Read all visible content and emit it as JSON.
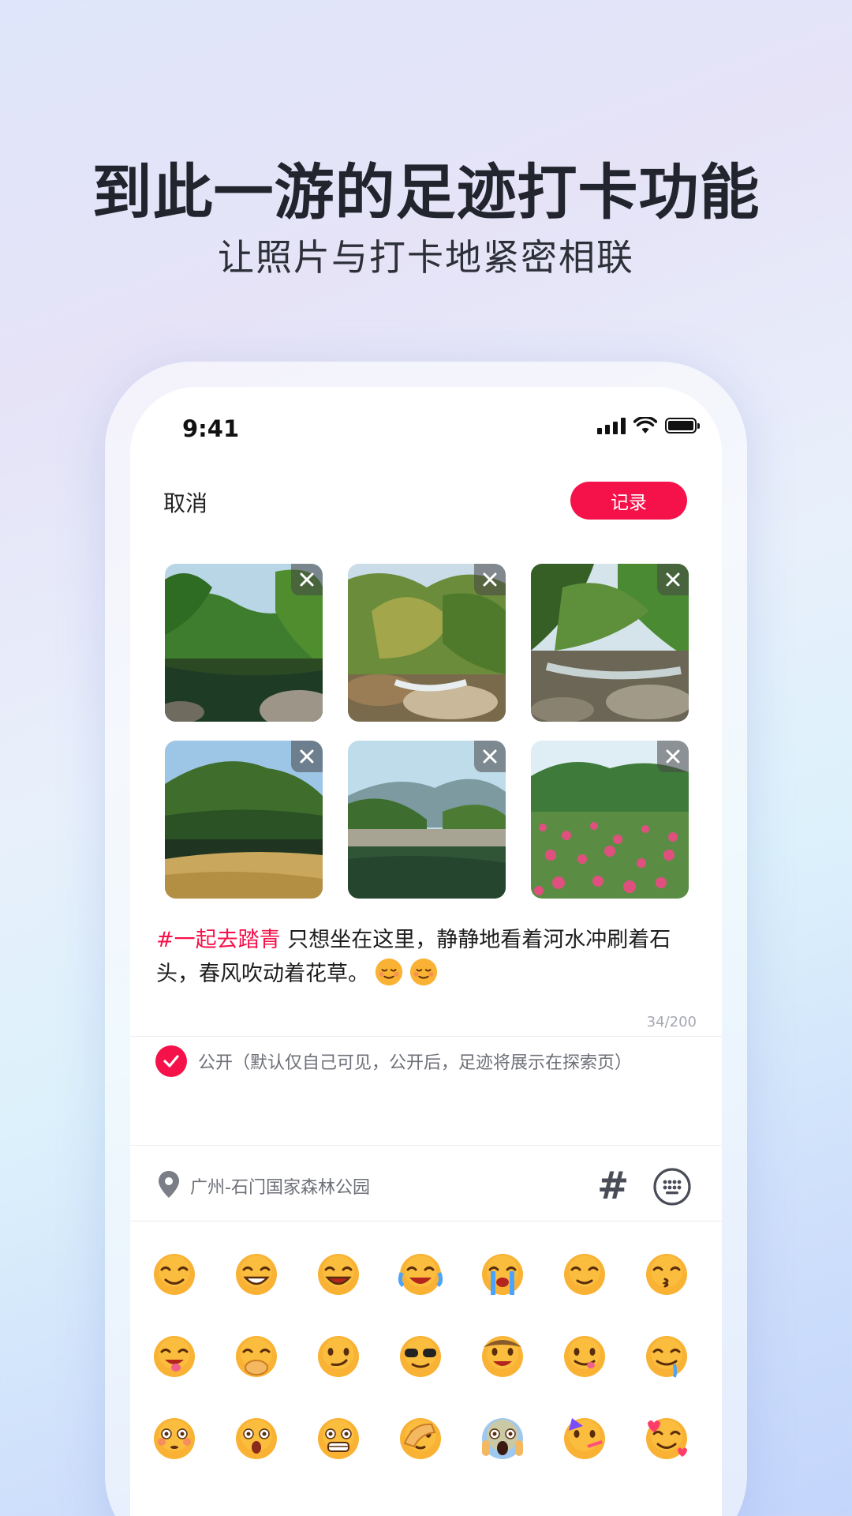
{
  "promo": {
    "headline": "到此一游的足迹打卡功能",
    "subline": "让照片与打卡地紧密相联"
  },
  "status_bar": {
    "time": "9:41"
  },
  "nav": {
    "cancel_label": "取消",
    "record_label": "记录"
  },
  "photos": [
    "river-forest",
    "stream-rocks",
    "creek-stones",
    "hill-lake",
    "mountain-lake",
    "flower-field"
  ],
  "post": {
    "hashtag": "#一起去踏青",
    "body": " 只想坐在这里，静静地看着河水冲刷着石头，春风吹动着花草。",
    "counter": "34/200"
  },
  "visibility": {
    "checked": true,
    "label": "公开（默认仅自己可见，公开后，足迹将展示在探索页）"
  },
  "location": {
    "text": "广州-石门国家森林公园"
  },
  "toolbar": {
    "hashtag_glyph": "#"
  },
  "emoji_panel": [
    "smiling-face",
    "grinning-teeth",
    "grinning-squint",
    "tears-of-joy",
    "loudly-crying",
    "relieved",
    "kissing",
    "squinting-tongue",
    "hand-over-mouth",
    "smirking",
    "sunglasses",
    "cowboy",
    "savoring-food",
    "drooling",
    "flushed",
    "hushed",
    "grimacing",
    "face-palm",
    "screaming",
    "partying",
    "smiling-hearts"
  ],
  "colors": {
    "accent": "#f5124a",
    "text": "#1d1d1d",
    "muted": "#6e7078"
  }
}
